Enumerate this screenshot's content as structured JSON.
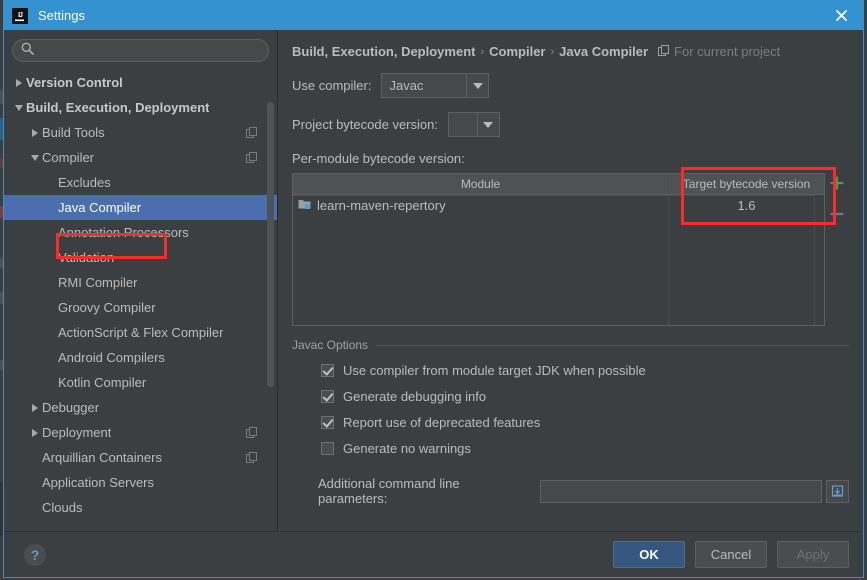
{
  "window": {
    "title": "Settings",
    "logo_text": "IJ",
    "close_label": "✕"
  },
  "sidebar": {
    "search": {
      "value": "",
      "placeholder": ""
    },
    "items": [
      {
        "label": "Version Control",
        "indent": 0,
        "twisty": "right",
        "bold": true,
        "selected": false,
        "scope_icon": false
      },
      {
        "label": "Build, Execution, Deployment",
        "indent": 0,
        "twisty": "down",
        "bold": true,
        "selected": false,
        "scope_icon": false
      },
      {
        "label": "Build Tools",
        "indent": 1,
        "twisty": "right",
        "bold": false,
        "selected": false,
        "scope_icon": true
      },
      {
        "label": "Compiler",
        "indent": 1,
        "twisty": "down",
        "bold": false,
        "selected": false,
        "scope_icon": true
      },
      {
        "label": "Excludes",
        "indent": 2,
        "twisty": "none",
        "bold": false,
        "selected": false,
        "scope_icon": false
      },
      {
        "label": "Java Compiler",
        "indent": 2,
        "twisty": "none",
        "bold": false,
        "selected": true,
        "scope_icon": false
      },
      {
        "label": "Annotation Processors",
        "indent": 2,
        "twisty": "none",
        "bold": false,
        "selected": false,
        "scope_icon": false
      },
      {
        "label": "Validation",
        "indent": 2,
        "twisty": "none",
        "bold": false,
        "selected": false,
        "scope_icon": false
      },
      {
        "label": "RMI Compiler",
        "indent": 2,
        "twisty": "none",
        "bold": false,
        "selected": false,
        "scope_icon": false
      },
      {
        "label": "Groovy Compiler",
        "indent": 2,
        "twisty": "none",
        "bold": false,
        "selected": false,
        "scope_icon": false
      },
      {
        "label": "ActionScript & Flex Compiler",
        "indent": 2,
        "twisty": "none",
        "bold": false,
        "selected": false,
        "scope_icon": false
      },
      {
        "label": "Android Compilers",
        "indent": 2,
        "twisty": "none",
        "bold": false,
        "selected": false,
        "scope_icon": false
      },
      {
        "label": "Kotlin Compiler",
        "indent": 2,
        "twisty": "none",
        "bold": false,
        "selected": false,
        "scope_icon": false
      },
      {
        "label": "Debugger",
        "indent": 1,
        "twisty": "right",
        "bold": false,
        "selected": false,
        "scope_icon": false
      },
      {
        "label": "Deployment",
        "indent": 1,
        "twisty": "right",
        "bold": false,
        "selected": false,
        "scope_icon": true
      },
      {
        "label": "Arquillian Containers",
        "indent": 1,
        "twisty": "none",
        "bold": false,
        "selected": false,
        "scope_icon": true
      },
      {
        "label": "Application Servers",
        "indent": 1,
        "twisty": "none",
        "bold": false,
        "selected": false,
        "scope_icon": false
      },
      {
        "label": "Clouds",
        "indent": 1,
        "twisty": "none",
        "bold": false,
        "selected": false,
        "scope_icon": false
      }
    ]
  },
  "main": {
    "breadcrumb": {
      "part1": "Build, Execution, Deployment",
      "sep1": "›",
      "part2": "Compiler",
      "sep2": "›",
      "part3": "Java Compiler",
      "scope_text": "For current project"
    },
    "use_compiler": {
      "label": "Use compiler:",
      "value": "Javac"
    },
    "project_bytecode": {
      "label": "Project bytecode version:",
      "value": ""
    },
    "per_module_label": "Per-module bytecode version:",
    "table": {
      "columns": [
        "Module",
        "Target bytecode version"
      ],
      "rows": [
        {
          "module": "learn-maven-repertory",
          "target": "1.6"
        }
      ],
      "add_label": "+",
      "remove_label": "–"
    },
    "javac_options": {
      "title": "Javac Options",
      "checkboxes": [
        {
          "label": "Use compiler from module target JDK when possible",
          "checked": true
        },
        {
          "label": "Generate debugging info",
          "checked": true
        },
        {
          "label": "Report use of deprecated features",
          "checked": true
        },
        {
          "label": "Generate no warnings",
          "checked": false
        }
      ],
      "params": {
        "label": "Additional command line parameters:",
        "value": "",
        "placeholder": ""
      }
    }
  },
  "footer": {
    "help_label": "?",
    "ok_label": "OK",
    "cancel_label": "Cancel",
    "apply_label": "Apply"
  },
  "colors": {
    "accent_blue": "#3592d1",
    "selection_blue": "#4b6eaf",
    "annotation_red": "#fc2b2b",
    "plus_green": "#499c54",
    "default_button_blue": "#365880"
  }
}
